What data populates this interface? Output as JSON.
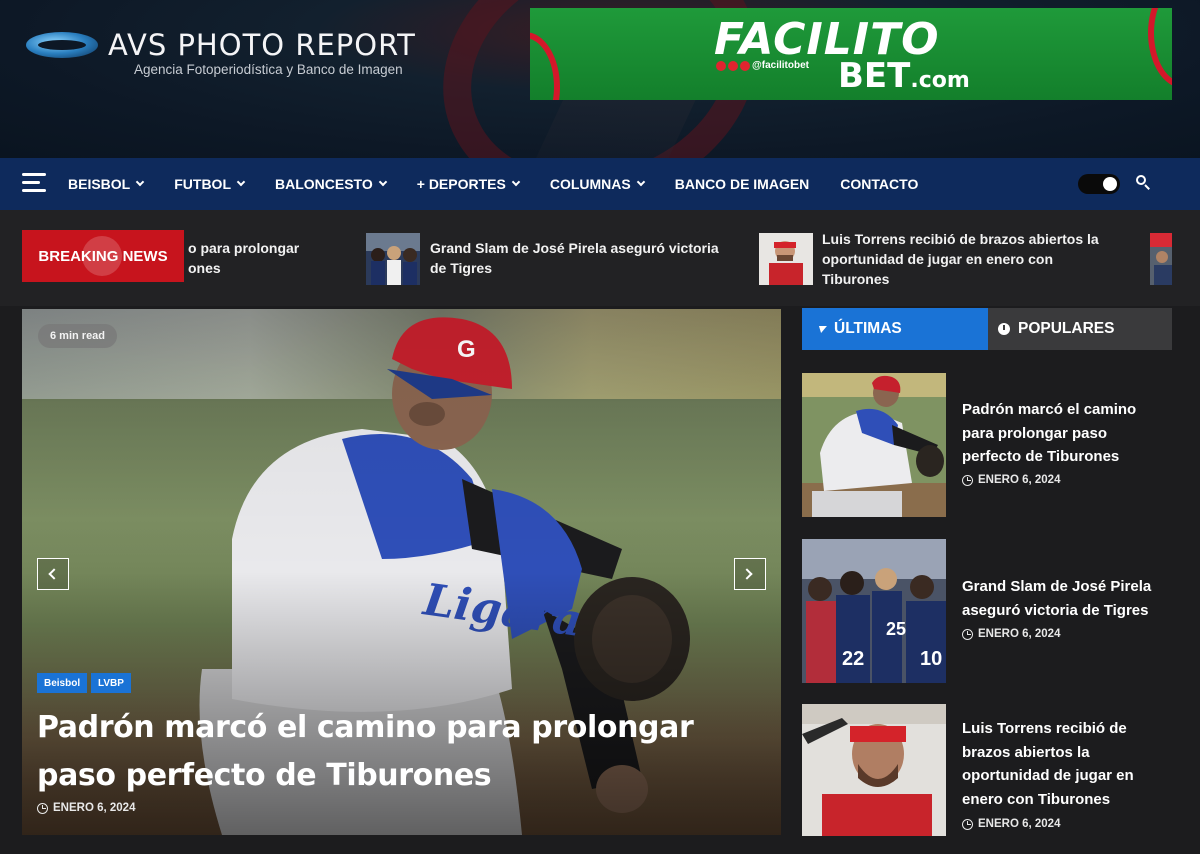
{
  "header": {
    "logo_title": "AVS PHOTO REPORT",
    "logo_subtitle": "Agencia Fotoperiodística y Banco de Imagen",
    "ad": {
      "brand_top": "FACILITO",
      "brand_bottom": "BET",
      "brand_tld": ".com",
      "handle": "@facilitobet",
      "color": "#1f9a3a"
    }
  },
  "nav": {
    "items": [
      {
        "label": "BEISBOL",
        "dropdown": true
      },
      {
        "label": "FUTBOL",
        "dropdown": true
      },
      {
        "label": "BALONCESTO",
        "dropdown": true
      },
      {
        "label": "+ DEPORTES",
        "dropdown": true
      },
      {
        "label": "COLUMNAS",
        "dropdown": true
      },
      {
        "label": "BANCO DE IMAGEN",
        "dropdown": false
      },
      {
        "label": "CONTACTO",
        "dropdown": false
      }
    ],
    "bg_color": "#0e2a5c"
  },
  "breaking": {
    "label": "BREAKING NEWS",
    "items": [
      {
        "text_line1": "o para prolongar",
        "text_line2": "ones"
      },
      {
        "text_line1": "Grand Slam de José Pirela aseguró victoria",
        "text_line2": "de Tigres"
      },
      {
        "text_line1": "Luis Torrens recibió de brazos abiertos la",
        "text_line2": "oportunidad de jugar en enero con",
        "text_line3": "Tiburones"
      }
    ]
  },
  "hero": {
    "read_time": "6 min read",
    "tags": [
      "Beisbol",
      "LVBP"
    ],
    "title": "Padrón marcó el camino para prolongar paso perfecto de Tiburones",
    "date": "ENERO 6, 2024"
  },
  "sidebar": {
    "tabs": [
      {
        "label": "ÚLTIMAS",
        "active": true,
        "icon": "bolt-icon"
      },
      {
        "label": "POPULARES",
        "active": false,
        "icon": "clock-icon"
      }
    ],
    "items": [
      {
        "title": "Padrón marcó el camino para prolongar paso perfecto de Tiburones",
        "date": "ENERO 6, 2024"
      },
      {
        "title": "Grand Slam de José Pirela aseguró victoria de Tigres",
        "date": "ENERO 6, 2024"
      },
      {
        "title": "Luis Torrens recibió de brazos abiertos la oportunidad de jugar en enero con Tiburones",
        "date": "ENERO 6, 2024"
      }
    ],
    "accent_color": "#1a73d6"
  }
}
